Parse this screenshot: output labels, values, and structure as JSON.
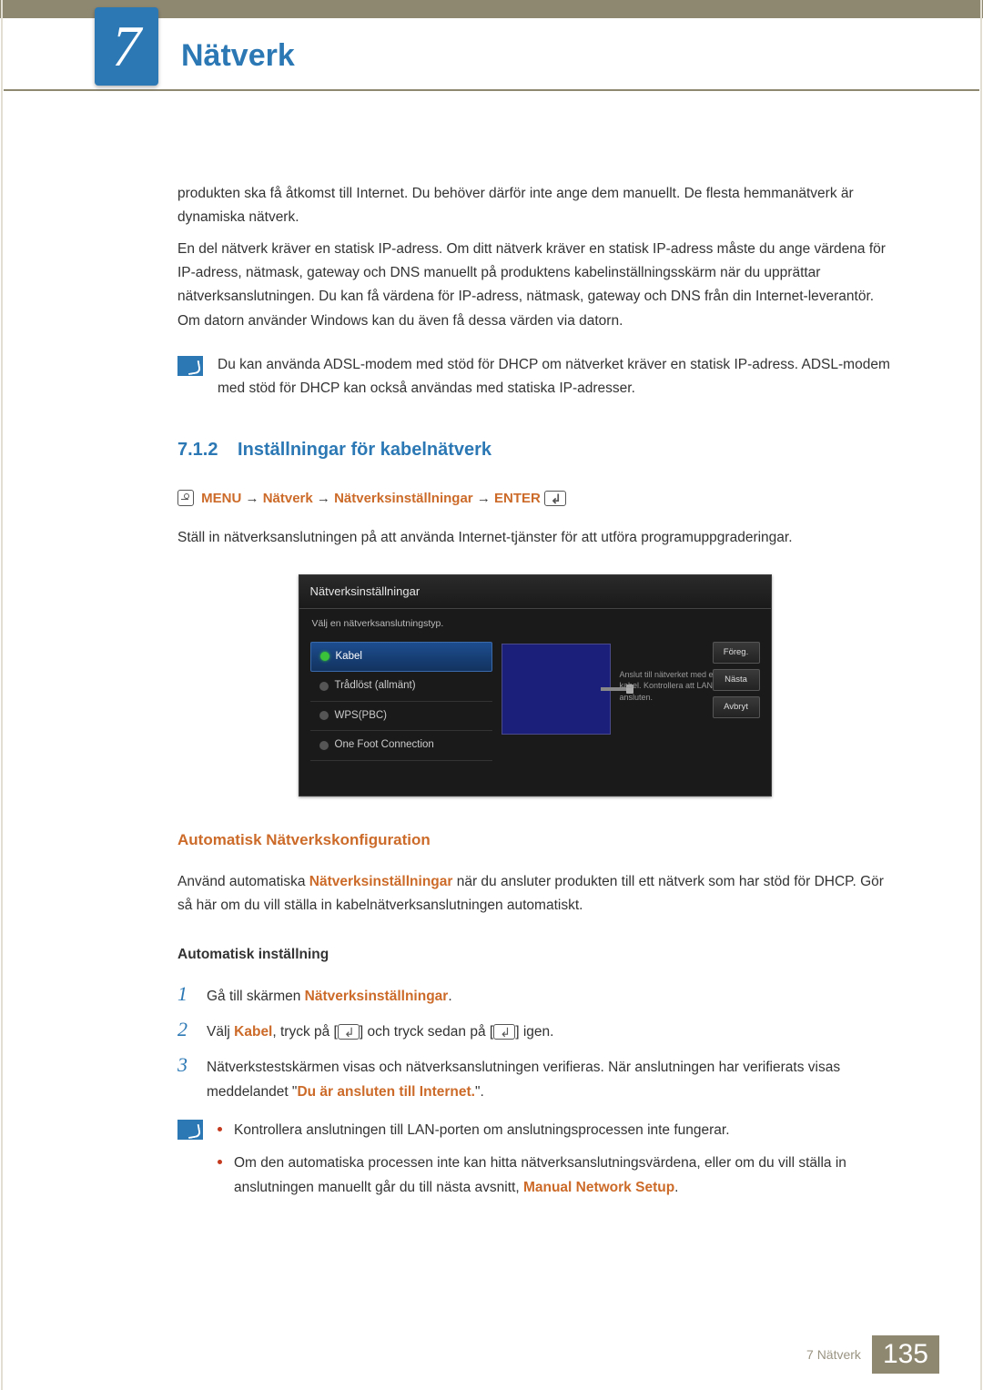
{
  "chapter": {
    "number": "7",
    "title": "Nätverk"
  },
  "intro_para1": "produkten ska få åtkomst till Internet. Du behöver därför inte ange dem manuellt. De flesta hemmanätverk är dynamiska nätverk.",
  "intro_para2": "En del nätverk kräver en statisk IP-adress. Om ditt nätverk kräver en statisk IP-adress måste du ange värdena för IP-adress, nätmask, gateway och DNS manuellt på produktens kabelinställningsskärm när du upprättar nätverksanslutningen. Du kan få värdena för IP-adress, nätmask, gateway och DNS från din Internet-leverantör. Om datorn använder Windows kan du även få dessa värden via datorn.",
  "note1": "Du kan använda ADSL-modem med stöd för DHCP om nätverket kräver en statisk IP-adress. ADSL-modem med stöd för DHCP kan också användas med statiska IP-adresser.",
  "section": {
    "number": "7.1.2",
    "title": "Inställningar för kabelnätverk"
  },
  "menu_path": {
    "m": "MENU",
    "p1": "Nätverk",
    "p2": "Nätverksinställningar",
    "enter": "ENTER",
    "arrow": "→"
  },
  "section_body": "Ställ in nätverksanslutningen på att använda Internet-tjänster för att utföra programuppgraderingar.",
  "ui": {
    "title": "Nätverksinställningar",
    "subtitle": "Välj en nätverksanslutningstyp.",
    "options": [
      "Kabel",
      "Trådlöst (allmänt)",
      "WPS(PBC)",
      "One Foot Connection"
    ],
    "hint": "Anslut till nätverket med en LAN-kabel. Kontrollera att LAN-kabeln är ansluten.",
    "buttons": [
      "Föreg.",
      "Nästa",
      "Avbryt"
    ]
  },
  "auto_config": {
    "heading": "Automatisk Nätverkskonfiguration",
    "para_a": "Använd automatiska ",
    "para_b": "Nätverksinställningar",
    "para_c": " när du ansluter produkten till ett nätverk som har stöd för DHCP. Gör så här om du vill ställa in kabelnätverksanslutningen automatiskt."
  },
  "auto_setting_h": "Automatisk inställning",
  "steps": {
    "s1a": "Gå till skärmen ",
    "s1b": "Nätverksinställningar",
    "s1c": ".",
    "s2a": "Välj ",
    "s2b": "Kabel",
    "s2c": ", tryck på [",
    "s2d": "] och tryck sedan på [",
    "s2e": "] igen.",
    "s3a": "Nätverkstestskärmen visas och nätverksanslutningen verifieras. När anslutningen har verifierats visas meddelandet \"",
    "s3b": "Du är ansluten till Internet.",
    "s3c": "\"."
  },
  "note2": {
    "b1": "Kontrollera anslutningen till LAN-porten om anslutningsprocessen inte fungerar.",
    "b2a": "Om den automatiska processen inte kan hitta nätverksanslutningsvärdena, eller om du vill ställa in anslutningen manuellt går du till nästa avsnitt, ",
    "b2b": "Manual Network Setup",
    "b2c": "."
  },
  "footer": {
    "label": "7 Nätverk",
    "page": "135"
  }
}
